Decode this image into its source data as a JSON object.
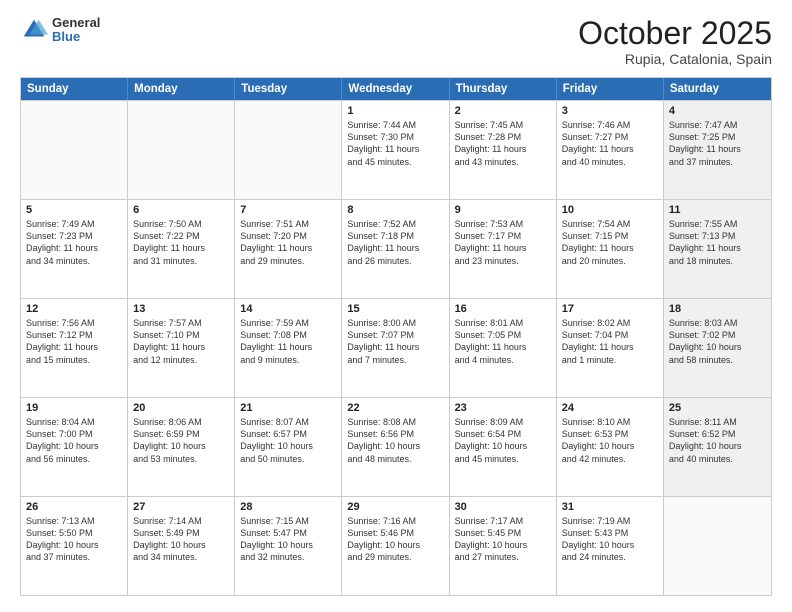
{
  "logo": {
    "general": "General",
    "blue": "Blue"
  },
  "title": "October 2025",
  "location": "Rupia, Catalonia, Spain",
  "headers": [
    "Sunday",
    "Monday",
    "Tuesday",
    "Wednesday",
    "Thursday",
    "Friday",
    "Saturday"
  ],
  "rows": [
    [
      {
        "day": "",
        "text": "",
        "empty": true
      },
      {
        "day": "",
        "text": "",
        "empty": true
      },
      {
        "day": "",
        "text": "",
        "empty": true
      },
      {
        "day": "1",
        "text": "Sunrise: 7:44 AM\nSunset: 7:30 PM\nDaylight: 11 hours\nand 45 minutes."
      },
      {
        "day": "2",
        "text": "Sunrise: 7:45 AM\nSunset: 7:28 PM\nDaylight: 11 hours\nand 43 minutes."
      },
      {
        "day": "3",
        "text": "Sunrise: 7:46 AM\nSunset: 7:27 PM\nDaylight: 11 hours\nand 40 minutes."
      },
      {
        "day": "4",
        "text": "Sunrise: 7:47 AM\nSunset: 7:25 PM\nDaylight: 11 hours\nand 37 minutes.",
        "shaded": true
      }
    ],
    [
      {
        "day": "5",
        "text": "Sunrise: 7:49 AM\nSunset: 7:23 PM\nDaylight: 11 hours\nand 34 minutes."
      },
      {
        "day": "6",
        "text": "Sunrise: 7:50 AM\nSunset: 7:22 PM\nDaylight: 11 hours\nand 31 minutes."
      },
      {
        "day": "7",
        "text": "Sunrise: 7:51 AM\nSunset: 7:20 PM\nDaylight: 11 hours\nand 29 minutes."
      },
      {
        "day": "8",
        "text": "Sunrise: 7:52 AM\nSunset: 7:18 PM\nDaylight: 11 hours\nand 26 minutes."
      },
      {
        "day": "9",
        "text": "Sunrise: 7:53 AM\nSunset: 7:17 PM\nDaylight: 11 hours\nand 23 minutes."
      },
      {
        "day": "10",
        "text": "Sunrise: 7:54 AM\nSunset: 7:15 PM\nDaylight: 11 hours\nand 20 minutes."
      },
      {
        "day": "11",
        "text": "Sunrise: 7:55 AM\nSunset: 7:13 PM\nDaylight: 11 hours\nand 18 minutes.",
        "shaded": true
      }
    ],
    [
      {
        "day": "12",
        "text": "Sunrise: 7:56 AM\nSunset: 7:12 PM\nDaylight: 11 hours\nand 15 minutes."
      },
      {
        "day": "13",
        "text": "Sunrise: 7:57 AM\nSunset: 7:10 PM\nDaylight: 11 hours\nand 12 minutes."
      },
      {
        "day": "14",
        "text": "Sunrise: 7:59 AM\nSunset: 7:08 PM\nDaylight: 11 hours\nand 9 minutes."
      },
      {
        "day": "15",
        "text": "Sunrise: 8:00 AM\nSunset: 7:07 PM\nDaylight: 11 hours\nand 7 minutes."
      },
      {
        "day": "16",
        "text": "Sunrise: 8:01 AM\nSunset: 7:05 PM\nDaylight: 11 hours\nand 4 minutes."
      },
      {
        "day": "17",
        "text": "Sunrise: 8:02 AM\nSunset: 7:04 PM\nDaylight: 11 hours\nand 1 minute."
      },
      {
        "day": "18",
        "text": "Sunrise: 8:03 AM\nSunset: 7:02 PM\nDaylight: 10 hours\nand 58 minutes.",
        "shaded": true
      }
    ],
    [
      {
        "day": "19",
        "text": "Sunrise: 8:04 AM\nSunset: 7:00 PM\nDaylight: 10 hours\nand 56 minutes."
      },
      {
        "day": "20",
        "text": "Sunrise: 8:06 AM\nSunset: 6:59 PM\nDaylight: 10 hours\nand 53 minutes."
      },
      {
        "day": "21",
        "text": "Sunrise: 8:07 AM\nSunset: 6:57 PM\nDaylight: 10 hours\nand 50 minutes."
      },
      {
        "day": "22",
        "text": "Sunrise: 8:08 AM\nSunset: 6:56 PM\nDaylight: 10 hours\nand 48 minutes."
      },
      {
        "day": "23",
        "text": "Sunrise: 8:09 AM\nSunset: 6:54 PM\nDaylight: 10 hours\nand 45 minutes."
      },
      {
        "day": "24",
        "text": "Sunrise: 8:10 AM\nSunset: 6:53 PM\nDaylight: 10 hours\nand 42 minutes."
      },
      {
        "day": "25",
        "text": "Sunrise: 8:11 AM\nSunset: 6:52 PM\nDaylight: 10 hours\nand 40 minutes.",
        "shaded": true
      }
    ],
    [
      {
        "day": "26",
        "text": "Sunrise: 7:13 AM\nSunset: 5:50 PM\nDaylight: 10 hours\nand 37 minutes."
      },
      {
        "day": "27",
        "text": "Sunrise: 7:14 AM\nSunset: 5:49 PM\nDaylight: 10 hours\nand 34 minutes."
      },
      {
        "day": "28",
        "text": "Sunrise: 7:15 AM\nSunset: 5:47 PM\nDaylight: 10 hours\nand 32 minutes."
      },
      {
        "day": "29",
        "text": "Sunrise: 7:16 AM\nSunset: 5:46 PM\nDaylight: 10 hours\nand 29 minutes."
      },
      {
        "day": "30",
        "text": "Sunrise: 7:17 AM\nSunset: 5:45 PM\nDaylight: 10 hours\nand 27 minutes."
      },
      {
        "day": "31",
        "text": "Sunrise: 7:19 AM\nSunset: 5:43 PM\nDaylight: 10 hours\nand 24 minutes."
      },
      {
        "day": "",
        "text": "",
        "empty": true,
        "shaded": true
      }
    ]
  ]
}
